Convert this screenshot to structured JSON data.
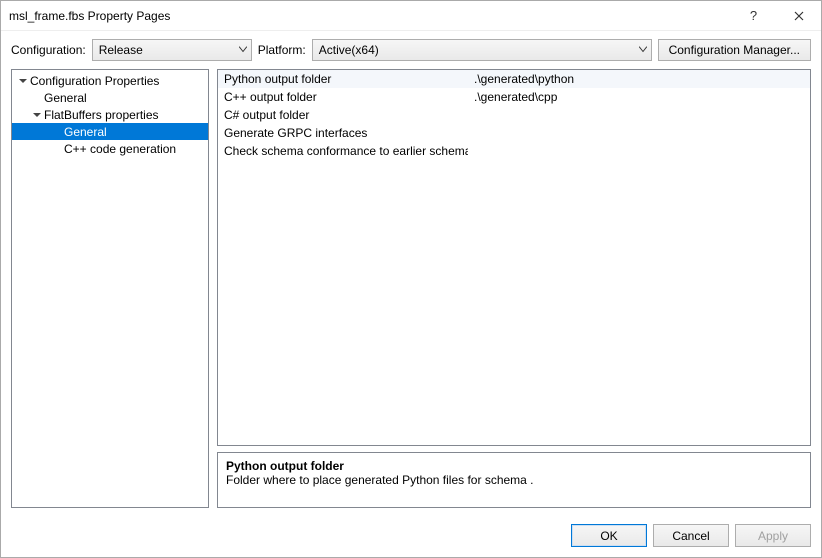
{
  "window": {
    "title": "msl_frame.fbs Property Pages"
  },
  "topbar": {
    "configuration_label": "Configuration:",
    "configuration_value": "Release",
    "platform_label": "Platform:",
    "platform_value": "Active(x64)",
    "config_manager_label": "Configuration Manager..."
  },
  "tree": {
    "root": "Configuration Properties",
    "items": [
      {
        "label": "General"
      },
      {
        "label": "FlatBuffers properties",
        "expanded": true,
        "children": [
          {
            "label": "General",
            "selected": true
          },
          {
            "label": "C++ code generation"
          }
        ]
      }
    ]
  },
  "grid": {
    "rows": [
      {
        "name": "Python output folder",
        "value": ".\\generated\\python",
        "highlight": true
      },
      {
        "name": "C++ output folder",
        "value": ".\\generated\\cpp"
      },
      {
        "name": "C# output folder",
        "value": ""
      },
      {
        "name": "Generate GRPC interfaces",
        "value": ""
      },
      {
        "name": "Check schema conformance to earlier schema",
        "value": ""
      }
    ]
  },
  "description": {
    "title": "Python output folder",
    "body": "Folder where to place generated Python files for schema ."
  },
  "footer": {
    "ok": "OK",
    "cancel": "Cancel",
    "apply": "Apply"
  }
}
